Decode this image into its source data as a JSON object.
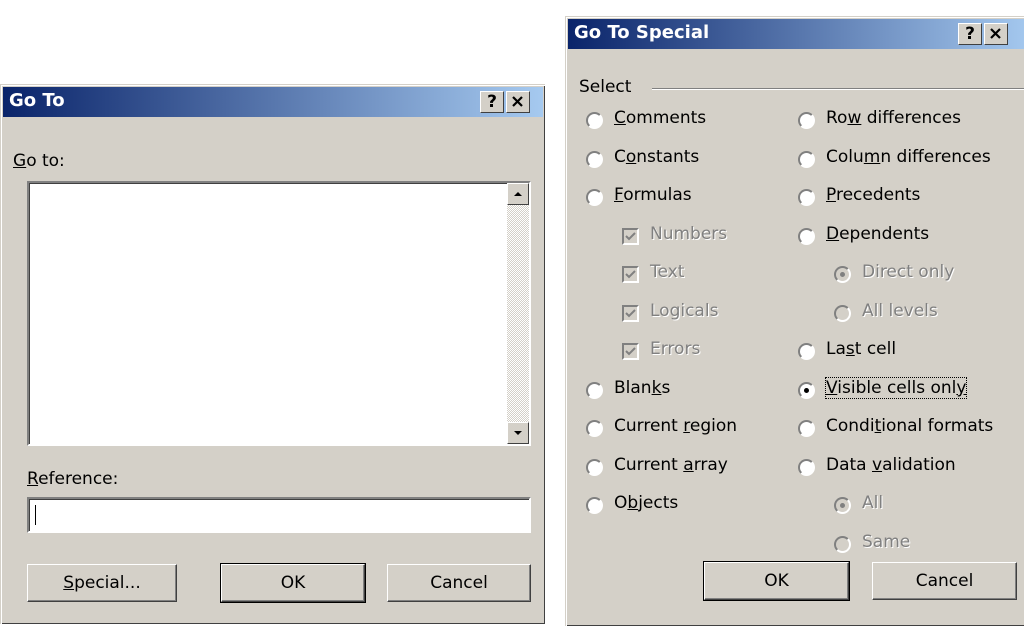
{
  "goto": {
    "title": "Go To",
    "help_btn": "?",
    "close_btn": "×",
    "goto_label_pre": "",
    "goto_label_u": "G",
    "goto_label_post": "o to:",
    "reference_label_u": "R",
    "reference_label_post": "eference:",
    "reference_value": "",
    "special_u": "S",
    "special_post": "pecial...",
    "ok": "OK",
    "cancel": "Cancel"
  },
  "goto_special": {
    "title": "Go To Special",
    "help_btn": "?",
    "close_btn": "×",
    "group_label": "Select",
    "left": [
      {
        "pre": "",
        "u": "C",
        "post": "omments",
        "state": "unchecked"
      },
      {
        "pre": "C",
        "u": "o",
        "post": "nstants",
        "state": "unchecked"
      },
      {
        "pre": "",
        "u": "F",
        "post": "ormulas",
        "state": "unchecked"
      },
      {
        "pre": "",
        "u": "",
        "post": "Numbers",
        "state": "checked-disabled"
      },
      {
        "pre": "",
        "u": "",
        "post": "Text",
        "state": "checked-disabled"
      },
      {
        "pre": "",
        "u": "",
        "post": "Logicals",
        "state": "checked-disabled"
      },
      {
        "pre": "",
        "u": "",
        "post": "Errors",
        "state": "checked-disabled"
      },
      {
        "pre": "Blan",
        "u": "k",
        "post": "s",
        "state": "unchecked"
      },
      {
        "pre": "Current ",
        "u": "r",
        "post": "egion",
        "state": "unchecked"
      },
      {
        "pre": "Current ",
        "u": "a",
        "post": "rray",
        "state": "unchecked"
      },
      {
        "pre": "O",
        "u": "b",
        "post": "jects",
        "state": "unchecked"
      }
    ],
    "right": [
      {
        "pre": "Ro",
        "u": "w",
        "post": " differences",
        "state": "unchecked"
      },
      {
        "pre": "Colu",
        "u": "m",
        "post": "n differences",
        "state": "unchecked"
      },
      {
        "pre": "",
        "u": "P",
        "post": "recedents",
        "state": "unchecked"
      },
      {
        "pre": "",
        "u": "D",
        "post": "ependents",
        "state": "unchecked"
      },
      {
        "pre": "",
        "u": "",
        "post": "Direct only",
        "state": "selected-disabled"
      },
      {
        "pre": "",
        "u": "",
        "post": "All levels",
        "state": "unselected-disabled"
      },
      {
        "pre": "La",
        "u": "s",
        "post": "t cell",
        "state": "unchecked"
      },
      {
        "pre": "",
        "u": "V",
        "post": "isible cells onl",
        "post2": "y",
        "state": "selected"
      },
      {
        "pre": "Condi",
        "u": "t",
        "post": "ional formats",
        "state": "unchecked"
      },
      {
        "pre": "Data ",
        "u": "v",
        "post": "alidation",
        "state": "unchecked"
      },
      {
        "pre": "",
        "u": "",
        "post": "All",
        "state": "selected-disabled"
      },
      {
        "pre": "",
        "u": "",
        "post": "Same",
        "state": "unselected-disabled"
      }
    ],
    "ok": "OK",
    "cancel": "Cancel"
  }
}
